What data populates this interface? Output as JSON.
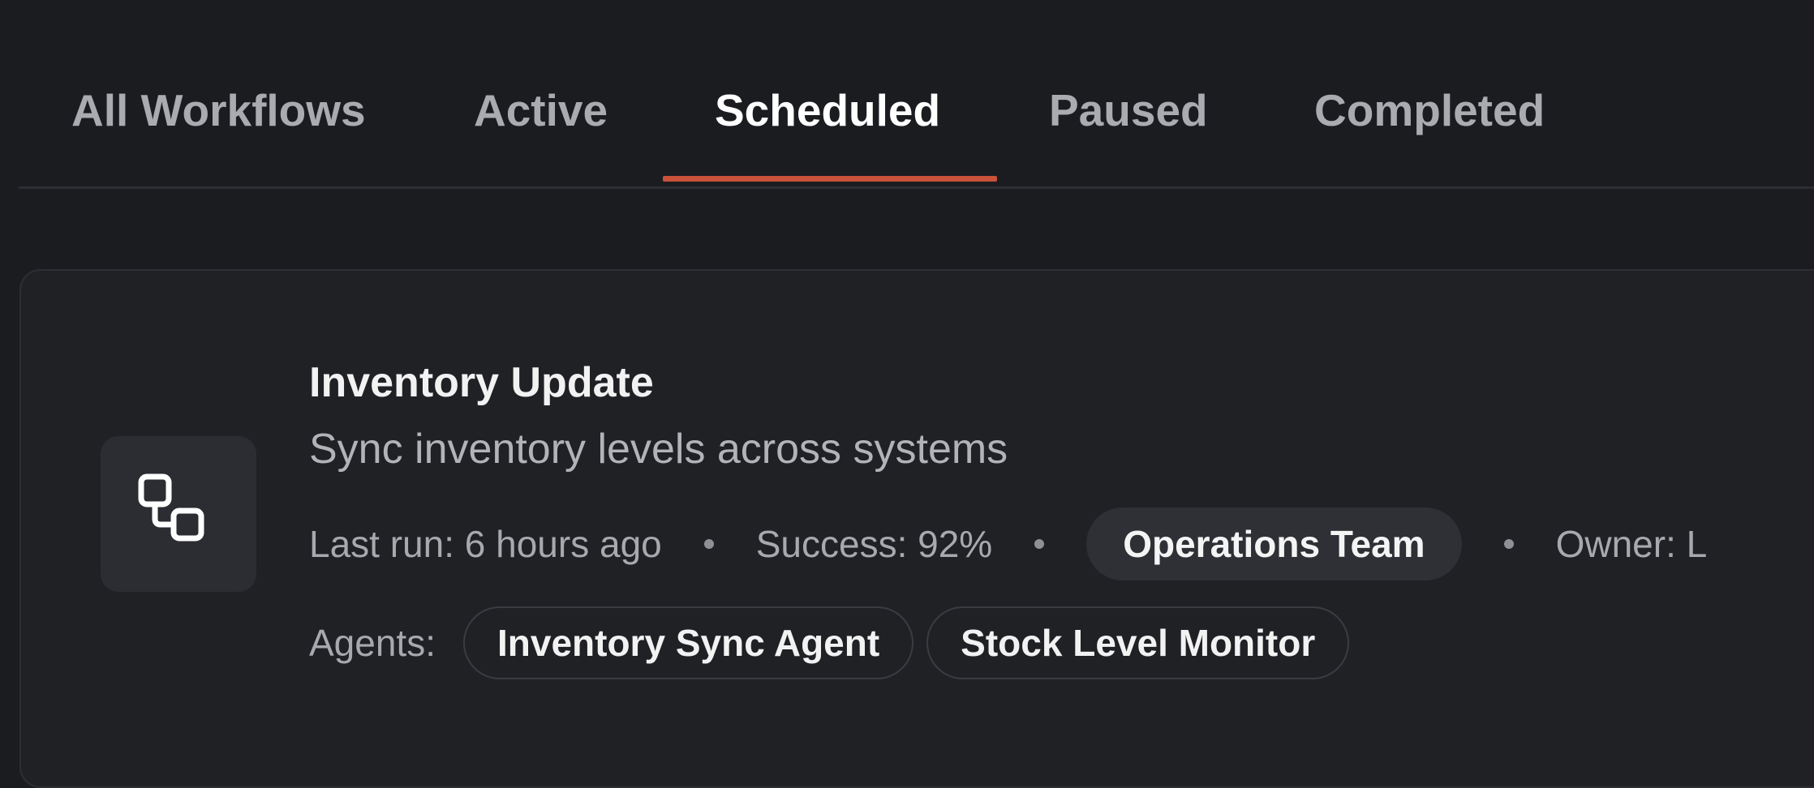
{
  "tabs": [
    {
      "label": "All Workflows",
      "active": false
    },
    {
      "label": "Active",
      "active": false
    },
    {
      "label": "Scheduled",
      "active": true
    },
    {
      "label": "Paused",
      "active": false
    },
    {
      "label": "Completed",
      "active": false
    }
  ],
  "workflow": {
    "icon": "workflow-icon",
    "title": "Inventory Update",
    "description": "Sync inventory levels across systems",
    "last_run": "Last run: 6 hours ago",
    "success": "Success: 92%",
    "team": "Operations Team",
    "owner": "Owner: L",
    "agents_label": "Agents:",
    "agents": [
      "Inventory Sync Agent",
      "Stock Level Monitor"
    ]
  },
  "colors": {
    "background": "#1b1c20",
    "card": "#202125",
    "accent": "#c9523a"
  }
}
